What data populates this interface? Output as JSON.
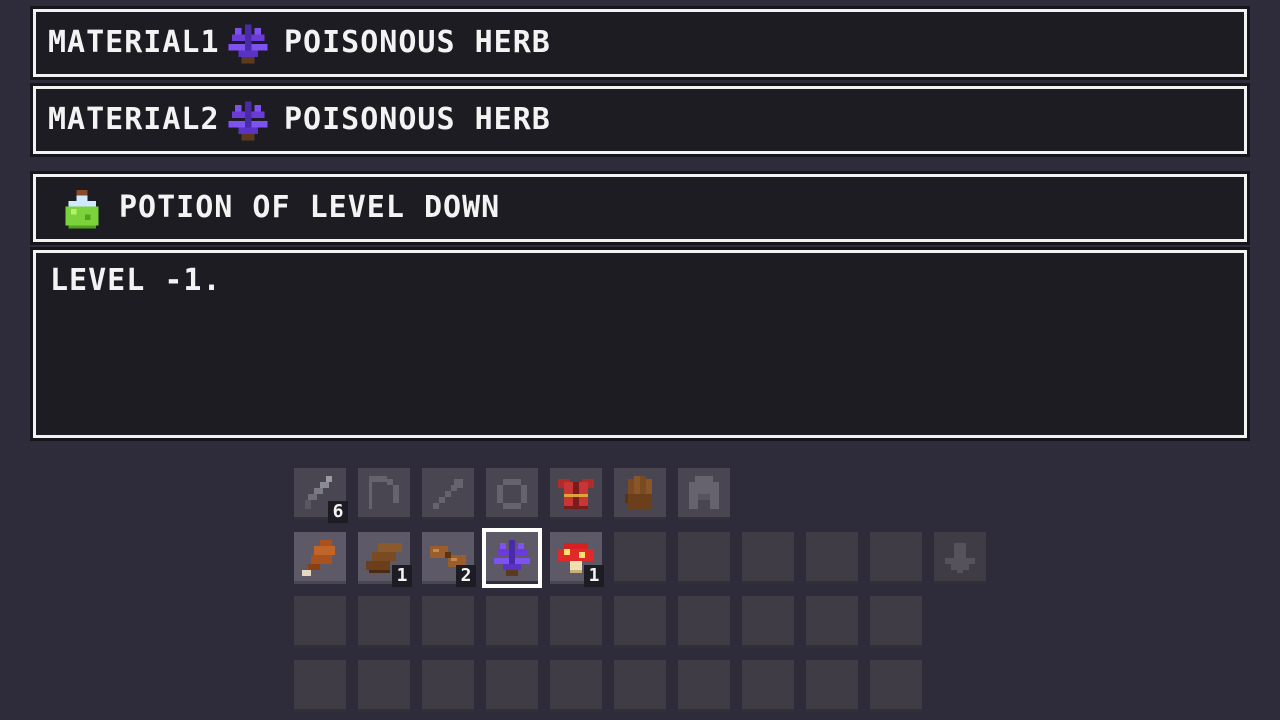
{
  "crafting": {
    "material1": {
      "label": "MATERIAL1",
      "item_name": "POISONOUS HERB",
      "icon": "herb-icon"
    },
    "material2": {
      "label": "MATERIAL2",
      "item_name": "POISONOUS HERB",
      "icon": "herb-icon"
    },
    "result": {
      "item_name": "POTION OF LEVEL DOWN",
      "icon": "potion-icon"
    },
    "description": "LEVEL -1."
  },
  "equipment_row": [
    {
      "icon": "dagger-icon",
      "count": "6"
    },
    {
      "icon": "bow-icon",
      "count": ""
    },
    {
      "icon": "arrow-icon",
      "count": ""
    },
    {
      "icon": "ring-icon",
      "count": ""
    },
    {
      "icon": "armor-icon",
      "count": ""
    },
    {
      "icon": "glove-icon",
      "count": ""
    },
    {
      "icon": "helmet-icon",
      "count": ""
    }
  ],
  "inventory": {
    "row1": [
      {
        "icon": "meat-icon",
        "count": ""
      },
      {
        "icon": "plank-icon",
        "count": "1"
      },
      {
        "icon": "sausage-icon",
        "count": "2"
      },
      {
        "icon": "herb-icon",
        "count": "",
        "selected": true
      },
      {
        "icon": "mushroom-icon",
        "count": "1"
      }
    ],
    "next_page_icon": "down-arrow-icon"
  },
  "colors": {
    "background": "#2e2b3a",
    "panel": "#1e1c23",
    "border": "#f2f2f2",
    "herb": "#6b3bd8",
    "potion": "#7bd23b"
  }
}
